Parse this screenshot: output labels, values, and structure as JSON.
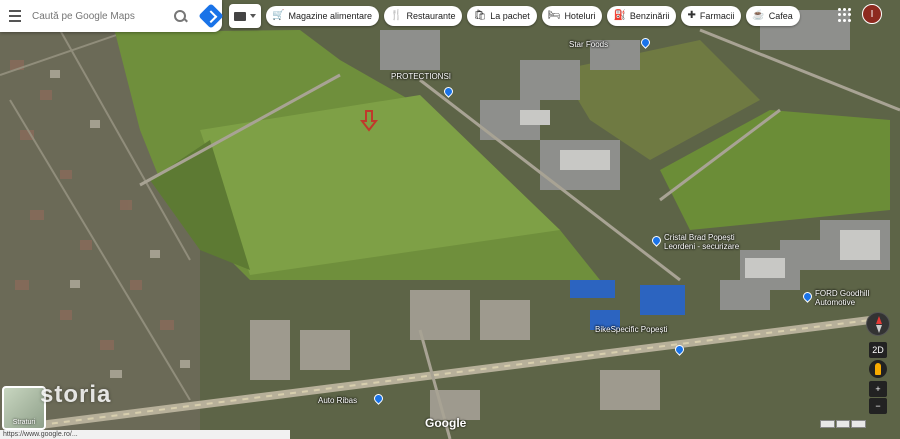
{
  "search": {
    "placeholder": "Caută pe Google Maps"
  },
  "chips": [
    {
      "icon": "cart-icon",
      "glyph": "🛒",
      "label": "Magazine alimentare"
    },
    {
      "icon": "fork-knife-icon",
      "glyph": "🍴",
      "label": "Restaurante"
    },
    {
      "icon": "takeout-bag-icon",
      "glyph": "🛍",
      "label": "La pachet"
    },
    {
      "icon": "bed-icon",
      "glyph": "🛏",
      "label": "Hoteluri"
    },
    {
      "icon": "fuel-pump-icon",
      "glyph": "⛽",
      "label": "Benzinării"
    },
    {
      "icon": "pharmacy-icon",
      "glyph": "✚",
      "label": "Farmacii"
    },
    {
      "icon": "coffee-cup-icon",
      "glyph": "☕",
      "label": "Cafea"
    }
  ],
  "account": {
    "initial": "I",
    "color": "#8d2a1f"
  },
  "places": {
    "star_foods": "Star Foods",
    "protectionsi": "PROTECTIONSI",
    "cristal": "Cristal Brad Popești Leordeni - securizare",
    "ford": "FORD Goodhill Automotive",
    "bike": "BikeSpecific Popești",
    "auto_ribas": "Auto Ribas"
  },
  "controls": {
    "tilt_label": "2D",
    "zoom_in": "+",
    "zoom_out": "−"
  },
  "layers": {
    "label": "Straturi"
  },
  "watermark": "storia",
  "brand": "Google",
  "url": "https://www.google.ro/...",
  "colors": {
    "accent": "#1a73e8",
    "marker": "#c0392b"
  }
}
